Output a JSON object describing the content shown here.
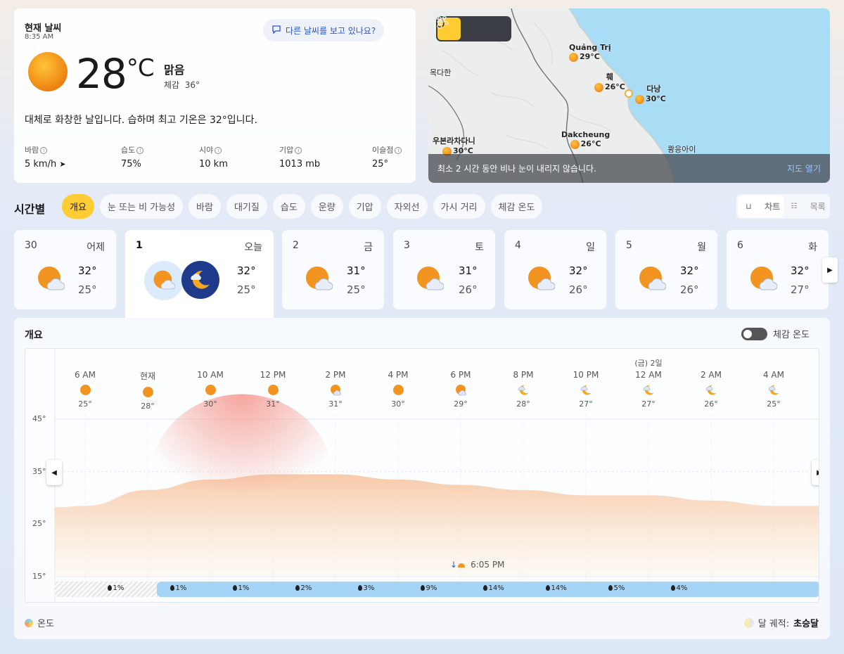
{
  "current": {
    "title": "현재 날씨",
    "time": "8:35 AM",
    "ask_button": "다른 날씨를 보고 있나요?",
    "temp": "28",
    "unit": "°C",
    "condition": "맑음",
    "feels_label": "체감",
    "feels_value": "36°",
    "description": "대체로 화창한 날입니다. 습하며 최고 기온은 32°입니다.",
    "stats": [
      {
        "label": "바람",
        "value": "5 km/h"
      },
      {
        "label": "습도",
        "value": "75%"
      },
      {
        "label": "시야",
        "value": "10 km"
      },
      {
        "label": "기압",
        "value": "1013 mb"
      },
      {
        "label": "이슬점",
        "value": "25°"
      }
    ]
  },
  "map": {
    "modes": [
      "precipitation-icon",
      "thermometer-icon",
      "wind-icon"
    ],
    "active_mode": "precipitation-icon",
    "cities": [
      {
        "name": "Quảng Trị",
        "temp": "29°C"
      },
      {
        "name": "훼",
        "temp": "26°C"
      },
      {
        "name": "다낭",
        "temp": "30°C"
      },
      {
        "name": "Dakcheung",
        "temp": "26°C"
      },
      {
        "name": "우본라차다니",
        "temp": "30°C"
      },
      {
        "name": "목다한",
        "temp": ""
      },
      {
        "name": "쾅응아이",
        "temp": ""
      }
    ],
    "footer_text": "최소 2 시간 동안 비나 눈이 내리지 않습니다.",
    "open_map": "지도 열기"
  },
  "hourly": {
    "title": "시간별",
    "tabs": [
      "개요",
      "눈 또는 비 가능성",
      "바람",
      "대기질",
      "습도",
      "운량",
      "기압",
      "자외선",
      "가시 거리",
      "체감 온도"
    ],
    "active_tab": "개요",
    "view_chart": "차트",
    "view_list": "목록"
  },
  "days": [
    {
      "num": "30",
      "weekday": "어제",
      "hi": "32°",
      "lo": "25°"
    },
    {
      "num": "1",
      "weekday": "오늘",
      "hi": "32°",
      "lo": "25°"
    },
    {
      "num": "2",
      "weekday": "금",
      "hi": "31°",
      "lo": "25°"
    },
    {
      "num": "3",
      "weekday": "토",
      "hi": "31°",
      "lo": "26°"
    },
    {
      "num": "4",
      "weekday": "일",
      "hi": "32°",
      "lo": "26°"
    },
    {
      "num": "5",
      "weekday": "월",
      "hi": "32°",
      "lo": "26°"
    },
    {
      "num": "6",
      "weekday": "화",
      "hi": "32°",
      "lo": "27°"
    }
  ],
  "overview": {
    "title": "개요",
    "feels_toggle": "체감 온도",
    "sunset": "6:05 PM",
    "legend_temp": "온도",
    "moon_label": "달 궤적:",
    "moon_phase": "초승달"
  },
  "chart_data": {
    "type": "area",
    "x": [
      "6 AM",
      "현재",
      "10 AM",
      "12 PM",
      "2 PM",
      "4 PM",
      "6 PM",
      "8 PM",
      "10 PM",
      "12 AM",
      "2 AM",
      "4 AM"
    ],
    "temps": [
      25,
      28,
      30,
      31,
      31,
      30,
      29,
      28,
      27,
      27,
      26,
      25
    ],
    "temp_labels": [
      "25°",
      "28°",
      "30°",
      "31°",
      "31°",
      "30°",
      "29°",
      "28°",
      "27°",
      "27°",
      "26°",
      "25°"
    ],
    "icons": [
      "sun",
      "sun",
      "sun",
      "sun",
      "sun-cloud",
      "sun",
      "sun-cloud",
      "moon-cloud",
      "moon-cloud",
      "moon-cloud",
      "moon-cloud",
      "moon-cloud"
    ],
    "date_marker": {
      "index": 9,
      "label": "(금) 2일"
    },
    "precip": [
      "1%",
      "1%",
      "1%",
      "2%",
      "3%",
      "9%",
      "14%",
      "14%",
      "5%",
      "4%"
    ],
    "ylim": [
      15,
      45
    ],
    "yticks": [
      "45°",
      "35°",
      "25°",
      "15°"
    ]
  }
}
